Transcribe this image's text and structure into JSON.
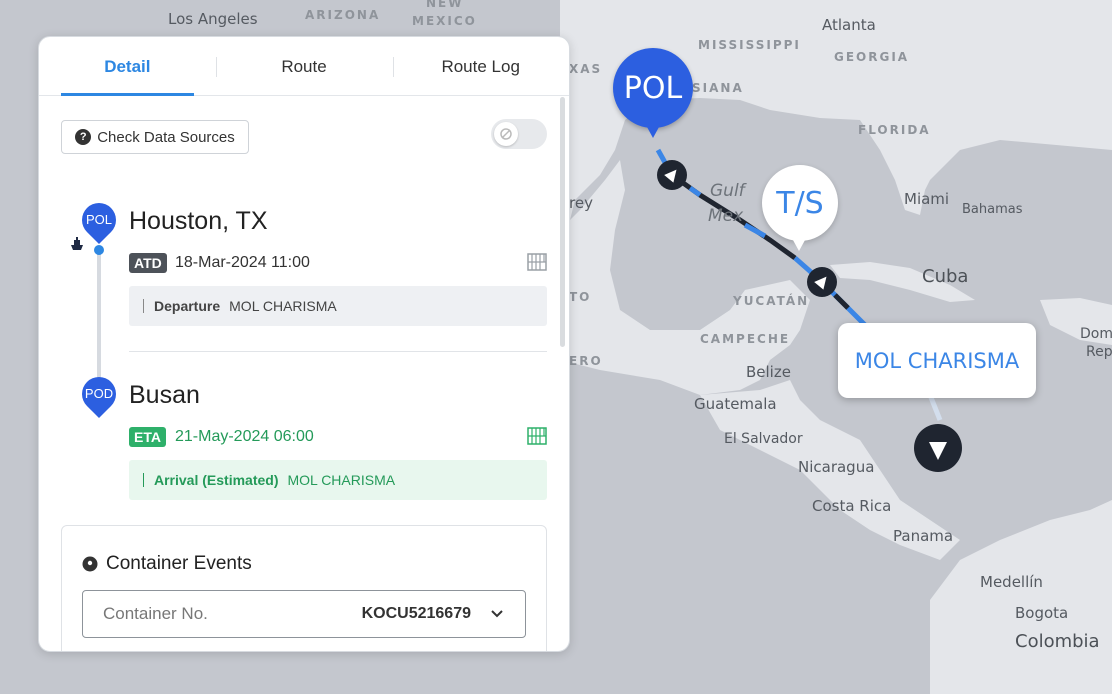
{
  "map": {
    "labels": {
      "los_angeles": "Los Angeles",
      "arizona": "ARIZONA",
      "new_mexico_1": "NEW",
      "new_mexico_2": "MEXICO",
      "texas": "XAS",
      "mississippi": "MISSISSIPPI",
      "atlanta": "Atlanta",
      "georgia": "GEORGIA",
      "louisiana": "SIANA",
      "florida": "FLORIDA",
      "gulf_1": "Gulf",
      "gulf_2": "Mex",
      "miami": "Miami",
      "bahamas": "Bahamas",
      "cuba": "Cuba",
      "rey": "rey",
      "to": "TO",
      "yucatan": "YUCATÁN",
      "campeche": "CAMPECHE",
      "ero": "ERO",
      "belize": "Belize",
      "guatemala": "Guatemala",
      "el_salvador": "El Salvador",
      "nicaragua": "Nicaragua",
      "costa_rica": "Costa Rica",
      "panama": "Panama",
      "medellin": "Medellín",
      "bogota": "Bogota",
      "colombia": "Colombia",
      "dom": "Dom",
      "rep": "Rep"
    },
    "pol_marker": "POL",
    "ts_marker": "T/S",
    "vessel_tooltip": "MOL CHARISMA"
  },
  "tabs": [
    "Detail",
    "Route",
    "Route Log"
  ],
  "check_sources": "Check Data Sources",
  "origin": {
    "pin": "POL",
    "city": "Houston, TX",
    "tag": "ATD",
    "date": "18-Mar-2024 11:00",
    "event": "Departure",
    "vessel": "MOL CHARISMA"
  },
  "destination": {
    "pin": "POD",
    "city": "Busan",
    "tag": "ETA",
    "date": "21-May-2024 06:00",
    "event": "Arrival (Estimated)",
    "vessel": "MOL CHARISMA"
  },
  "container_events": {
    "title": "Container Events",
    "field_label": "Container No.",
    "field_value": "KOCU5216679"
  },
  "colors": {
    "accent": "#2d87e2",
    "pol_blue": "#2c5fe0",
    "green": "#2eb06a"
  }
}
